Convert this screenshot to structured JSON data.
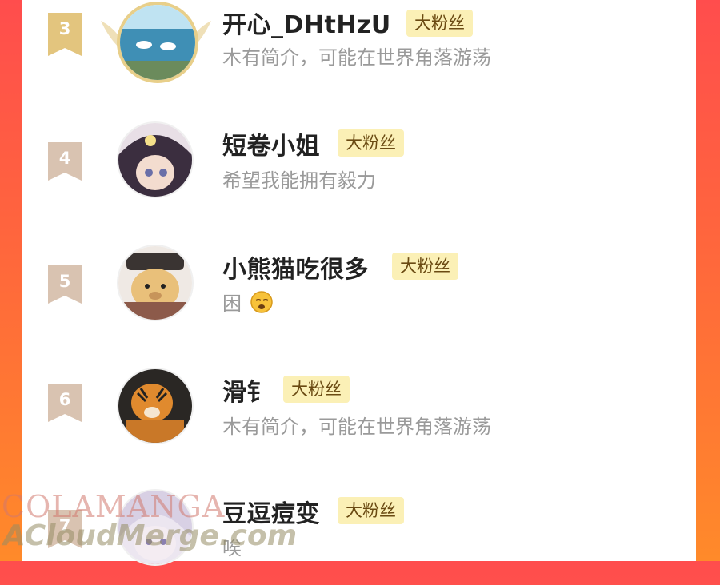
{
  "badge_label": "大粉丝",
  "fans": [
    {
      "rank": "3",
      "name": "开心_DHtHzU",
      "bio": "木有简介，可能在世界角落游荡"
    },
    {
      "rank": "4",
      "name": "短卷小姐",
      "bio": "希望我能拥有毅力"
    },
    {
      "rank": "5",
      "name": "小熊猫吃很多",
      "bio": "困"
    },
    {
      "rank": "6",
      "name": "滑钅",
      "bio": "木有简介，可能在世界角落游荡"
    },
    {
      "rank": "7",
      "name": "豆逗痘变",
      "bio": "唉"
    }
  ],
  "watermark": {
    "line1": "COLAMANGA",
    "line2": "ACloudMerge.com"
  },
  "colors": {
    "badge_bg": "#fbf0b6",
    "rank_gold": "#e3c57e",
    "rank_gray": "#d9c3b1",
    "frame_red": "#ff4d4d",
    "frame_orange": "#ff8a2a"
  }
}
